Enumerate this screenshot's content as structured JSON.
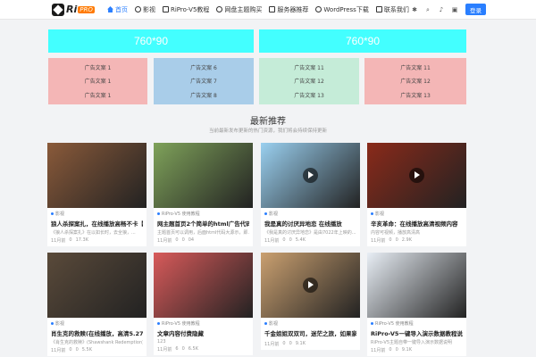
{
  "header": {
    "logo_text": "Ri",
    "logo_badge": "PRO",
    "nav": [
      {
        "label": "首页",
        "active": true,
        "icon": "home-icon"
      },
      {
        "label": "影视",
        "active": false,
        "icon": "film-icon"
      },
      {
        "label": "RiPro-V5教程",
        "active": false,
        "icon": "book-icon"
      },
      {
        "label": "网盘主题购买",
        "active": false,
        "icon": "cart-icon"
      },
      {
        "label": "服务器推荐",
        "active": false,
        "icon": "server-icon"
      },
      {
        "label": "WordPress下载",
        "active": false,
        "icon": "wordpress-icon"
      },
      {
        "label": "联系我们",
        "active": false,
        "icon": "contact-icon"
      }
    ],
    "login_label": "登录"
  },
  "banners": [
    "760*90",
    "760*90"
  ],
  "ads": [
    {
      "color": "#f4b6b6",
      "lines": [
        "广告文案 1",
        "广告文案 1",
        "广告文案 1"
      ]
    },
    {
      "color": "#a9cde9",
      "lines": [
        "广告文案 6",
        "广告文案 7",
        "广告文案 8"
      ]
    },
    {
      "color": "#c5ecd8",
      "lines": [
        "广告文案 11",
        "广告文案 12",
        "广告文案 13"
      ]
    },
    {
      "color": "#f4b6b6",
      "lines": [
        "广告文案 11",
        "广告文案 12",
        "广告文案 13"
      ]
    }
  ],
  "section": {
    "title": "最新推荐",
    "subtitle": "当前最新发布更新的热门资源，我们将会持续保持更新"
  },
  "cards": [
    {
      "category": "影视",
      "title": "狼人杀探案扎，在线播放高畅不卡【2.5...",
      "desc": "《狼人杀探案扎》在以如长时，去全狼，...",
      "meta": [
        "11月前",
        "0",
        "17.3K"
      ],
      "thumb": "#8a5a3a",
      "play": false
    },
    {
      "category": "RiPro-V5 使用教程",
      "title": "网主题首页2个简单的html广告代码",
      "desc": "主题首页可以调用，后面html代码大源示，即...",
      "meta": [
        "11月前",
        "0",
        "0",
        "04"
      ],
      "thumb": "#7fa25a",
      "play": false
    },
    {
      "category": "影视",
      "title": "我是真的讨厌异地恋 在线播放",
      "desc": "《我是真的讨厌异地恋》是由7022年上映的...",
      "meta": [
        "11月前",
        "0",
        "0",
        "5.4K"
      ],
      "thumb": "#9ad0f0",
      "play": true
    },
    {
      "category": "影视",
      "title": "辛亥革命：在线播放高清视频内容",
      "desc": "内容可视频，播放高清高",
      "meta": [
        "11月前",
        "0",
        "0",
        "2.9K"
      ],
      "thumb": "#8a2a1a",
      "play": true
    },
    {
      "category": "影视",
      "title": "肖生克的救赎(在线播放，高清5.27GB)",
      "desc": "《肖生克的救赎》(Shawshank Redemption)",
      "meta": [
        "11月前",
        "0",
        "0",
        "5.5K"
      ],
      "thumb": "#5a4a3a",
      "play": false
    },
    {
      "category": "RiPro-V5 使用教程",
      "title": "文章内容付费隐藏",
      "desc": "123",
      "meta": [
        "11月前",
        "6",
        "0",
        "6.5K"
      ],
      "thumb": "#d85a5a",
      "play": false
    },
    {
      "category": "影视",
      "title": "千金姐姐双双司，迷茫之旅，如果家...",
      "desc": "",
      "meta": [
        "11月前",
        "0",
        "0",
        "9.1K"
      ],
      "thumb": "#caa070",
      "play": true
    },
    {
      "category": "RiPro-V5 使用教程",
      "title": "RiPro-V5一键导入演示数据教程说明",
      "desc": "RiPro-V5主题自带一键导入演示数据说明",
      "meta": [
        "11月前",
        "0",
        "0",
        "9.1K"
      ],
      "thumb": "#e8eef5",
      "play": false
    }
  ]
}
